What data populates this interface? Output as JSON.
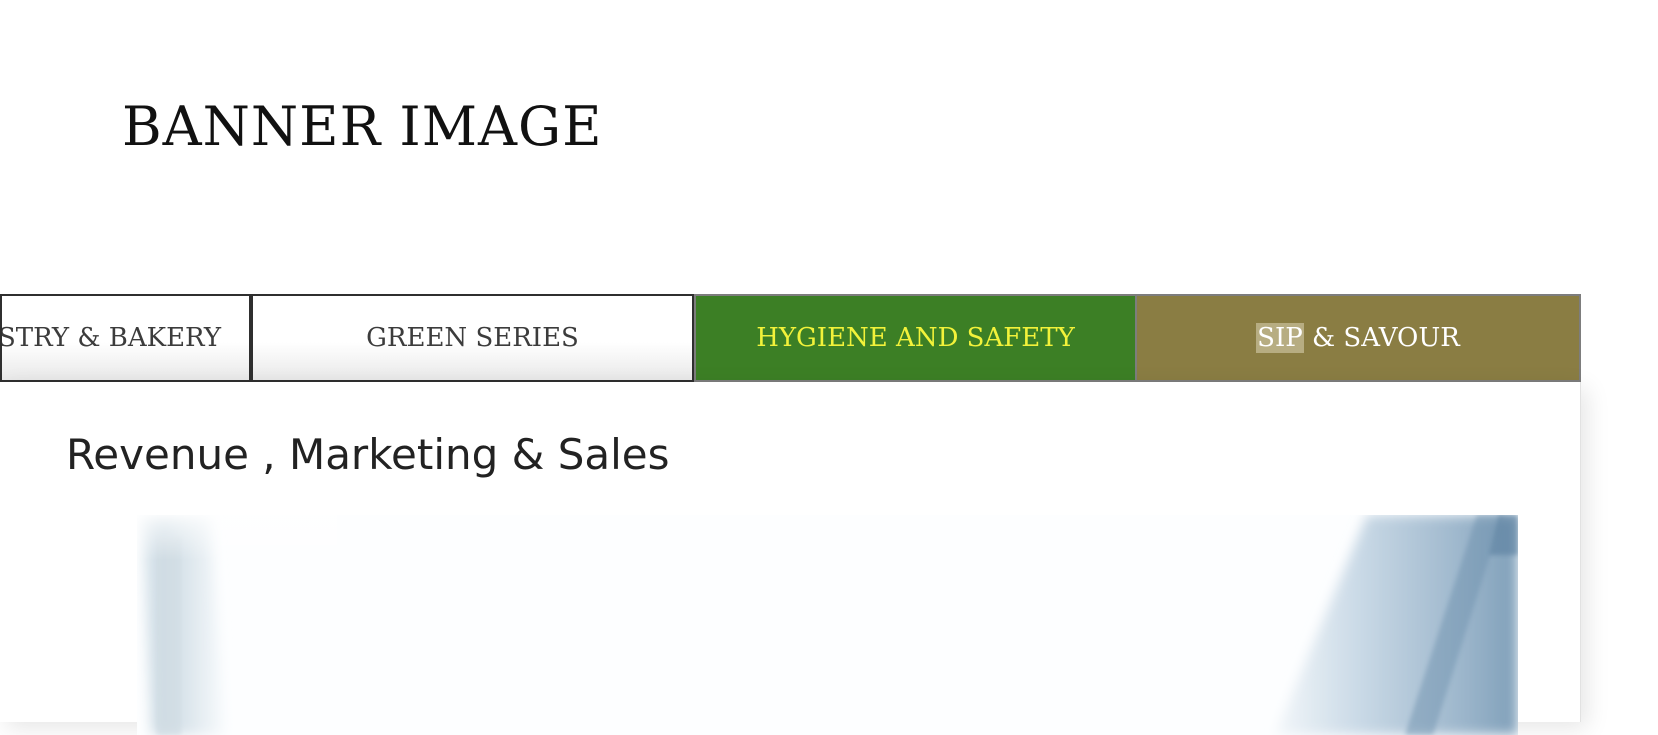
{
  "banner": {
    "title": "BANNER IMAGE"
  },
  "tabs": [
    {
      "label": "PASTRY & BAKERY",
      "visible_label": "STRY & BAKERY",
      "state": "default"
    },
    {
      "label": "GREEN SERIES",
      "state": "default"
    },
    {
      "label": "HYGIENE AND SAFETY",
      "state": "highlighted"
    },
    {
      "label_highlighted_part": "SIP",
      "label_rest": " & SAVOUR",
      "state": "active"
    }
  ],
  "content": {
    "heading": "Revenue , Marketing & Sales"
  },
  "colors": {
    "hygiene_tab_bg": "#3c7f25",
    "hygiene_tab_text": "#f2f23a",
    "sip_tab_bg": "#8a7d43",
    "sip_tab_text": "#ffffff",
    "default_tab_text": "#3c3c3c"
  }
}
